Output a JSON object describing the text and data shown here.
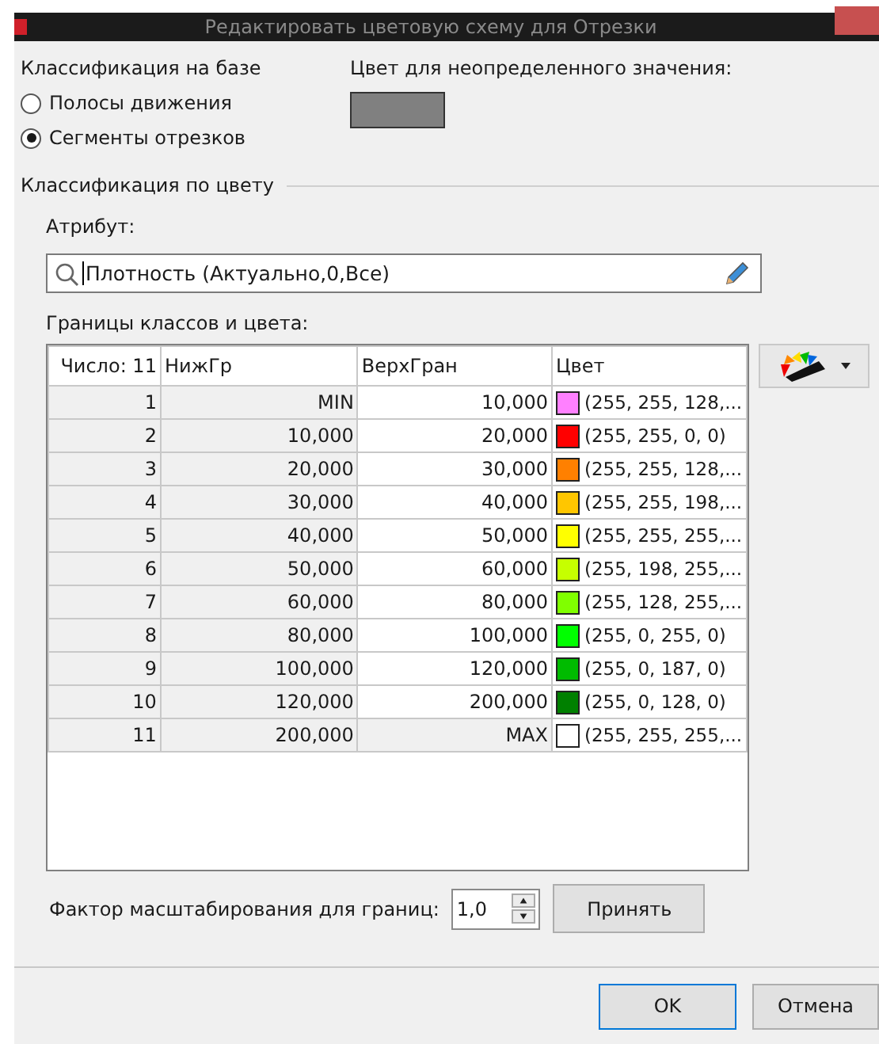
{
  "window": {
    "title": "Редактировать цветовую схему для Отрезки"
  },
  "classification": {
    "label": "Классификация на базе",
    "options": [
      {
        "label": "Полосы движения",
        "selected": false
      },
      {
        "label": "Сегменты отрезков",
        "selected": true
      }
    ]
  },
  "undefined_color": {
    "label": "Цвет для неопределенного значения:",
    "color": "#808080"
  },
  "color_group": {
    "title": "Классификация по цвету",
    "attribute_label": "Атрибут:",
    "attribute_value": "Плотность (Актуально,0,Все)",
    "table_label": "Границы классов и цвета:"
  },
  "table": {
    "columns": [
      "Число: 11",
      "НижГр",
      "ВерхГран",
      "Цвет"
    ],
    "rows": [
      {
        "index": "1",
        "low": "MIN",
        "high": "10,000",
        "high_editable": true,
        "color": "#ff80ff",
        "color_text": "(255, 255, 128,..."
      },
      {
        "index": "2",
        "low": "10,000",
        "high": "20,000",
        "high_editable": true,
        "color": "#ff0000",
        "color_text": "(255, 255, 0, 0)"
      },
      {
        "index": "3",
        "low": "20,000",
        "high": "30,000",
        "high_editable": true,
        "color": "#ff8000",
        "color_text": "(255, 255, 128,..."
      },
      {
        "index": "4",
        "low": "30,000",
        "high": "40,000",
        "high_editable": true,
        "color": "#ffc600",
        "color_text": "(255, 255, 198,..."
      },
      {
        "index": "5",
        "low": "40,000",
        "high": "50,000",
        "high_editable": true,
        "color": "#ffff00",
        "color_text": "(255, 255, 255,..."
      },
      {
        "index": "6",
        "low": "50,000",
        "high": "60,000",
        "high_editable": true,
        "color": "#c6ff00",
        "color_text": "(255, 198, 255,..."
      },
      {
        "index": "7",
        "low": "60,000",
        "high": "80,000",
        "high_editable": true,
        "color": "#80ff00",
        "color_text": "(255, 128, 255,..."
      },
      {
        "index": "8",
        "low": "80,000",
        "high": "100,000",
        "high_editable": true,
        "color": "#00ff00",
        "color_text": "(255, 0, 255, 0)"
      },
      {
        "index": "9",
        "low": "100,000",
        "high": "120,000",
        "high_editable": true,
        "color": "#00bb00",
        "color_text": "(255, 0, 187, 0)"
      },
      {
        "index": "10",
        "low": "120,000",
        "high": "200,000",
        "high_editable": true,
        "color": "#008000",
        "color_text": "(255, 0, 128, 0)"
      },
      {
        "index": "11",
        "low": "200,000",
        "high": "MAX",
        "high_editable": false,
        "color": "#ffffff",
        "color_text": "(255, 255, 255,..."
      }
    ]
  },
  "scale": {
    "label": "Фактор масштабирования для границ:",
    "value": "1,0",
    "apply": "Принять"
  },
  "buttons": [
    "OK",
    "Отмена"
  ]
}
